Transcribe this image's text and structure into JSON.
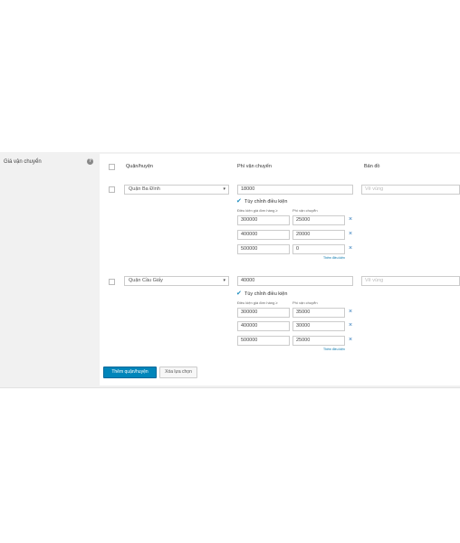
{
  "section": {
    "label": "Giá vận chuyển",
    "help_icon": "question-icon"
  },
  "table": {
    "headers": {
      "district": "Quận/huyện",
      "fee": "Phí vận chuyển",
      "map": "Bản đồ"
    }
  },
  "rows": [
    {
      "district": "Quận Ba Đình",
      "fee": "18000",
      "map_placeholder": "Vẽ vùng",
      "custom_toggle_label": "Tùy chỉnh điều kiện",
      "cond_headers": {
        "min_order": "Điều kiện giá đơn hàng ≥",
        "fee": "Phí vận chuyển"
      },
      "conditions": [
        {
          "min": "300000",
          "fee": "25000"
        },
        {
          "min": "400000",
          "fee": "20000"
        },
        {
          "min": "500000",
          "fee": "0"
        }
      ],
      "add_condition_link": "Thêm điều kiện"
    },
    {
      "district": "Quận Cầu Giấy",
      "fee": "40000",
      "map_placeholder": "Vẽ vùng",
      "custom_toggle_label": "Tùy chỉnh điều kiện",
      "cond_headers": {
        "min_order": "Điều kiện giá đơn hàng ≥",
        "fee": "Phí vận chuyển"
      },
      "conditions": [
        {
          "min": "300000",
          "fee": "35000"
        },
        {
          "min": "400000",
          "fee": "30000"
        },
        {
          "min": "500000",
          "fee": "25000"
        }
      ],
      "add_condition_link": "Thêm điều kiện"
    }
  ],
  "actions": {
    "add": "Thêm quận/huyện",
    "delete": "Xóa lựa chọn"
  },
  "colors": {
    "primary": "#0085ba",
    "accent": "#1e8cbe",
    "panel": "#f1f1f1"
  }
}
